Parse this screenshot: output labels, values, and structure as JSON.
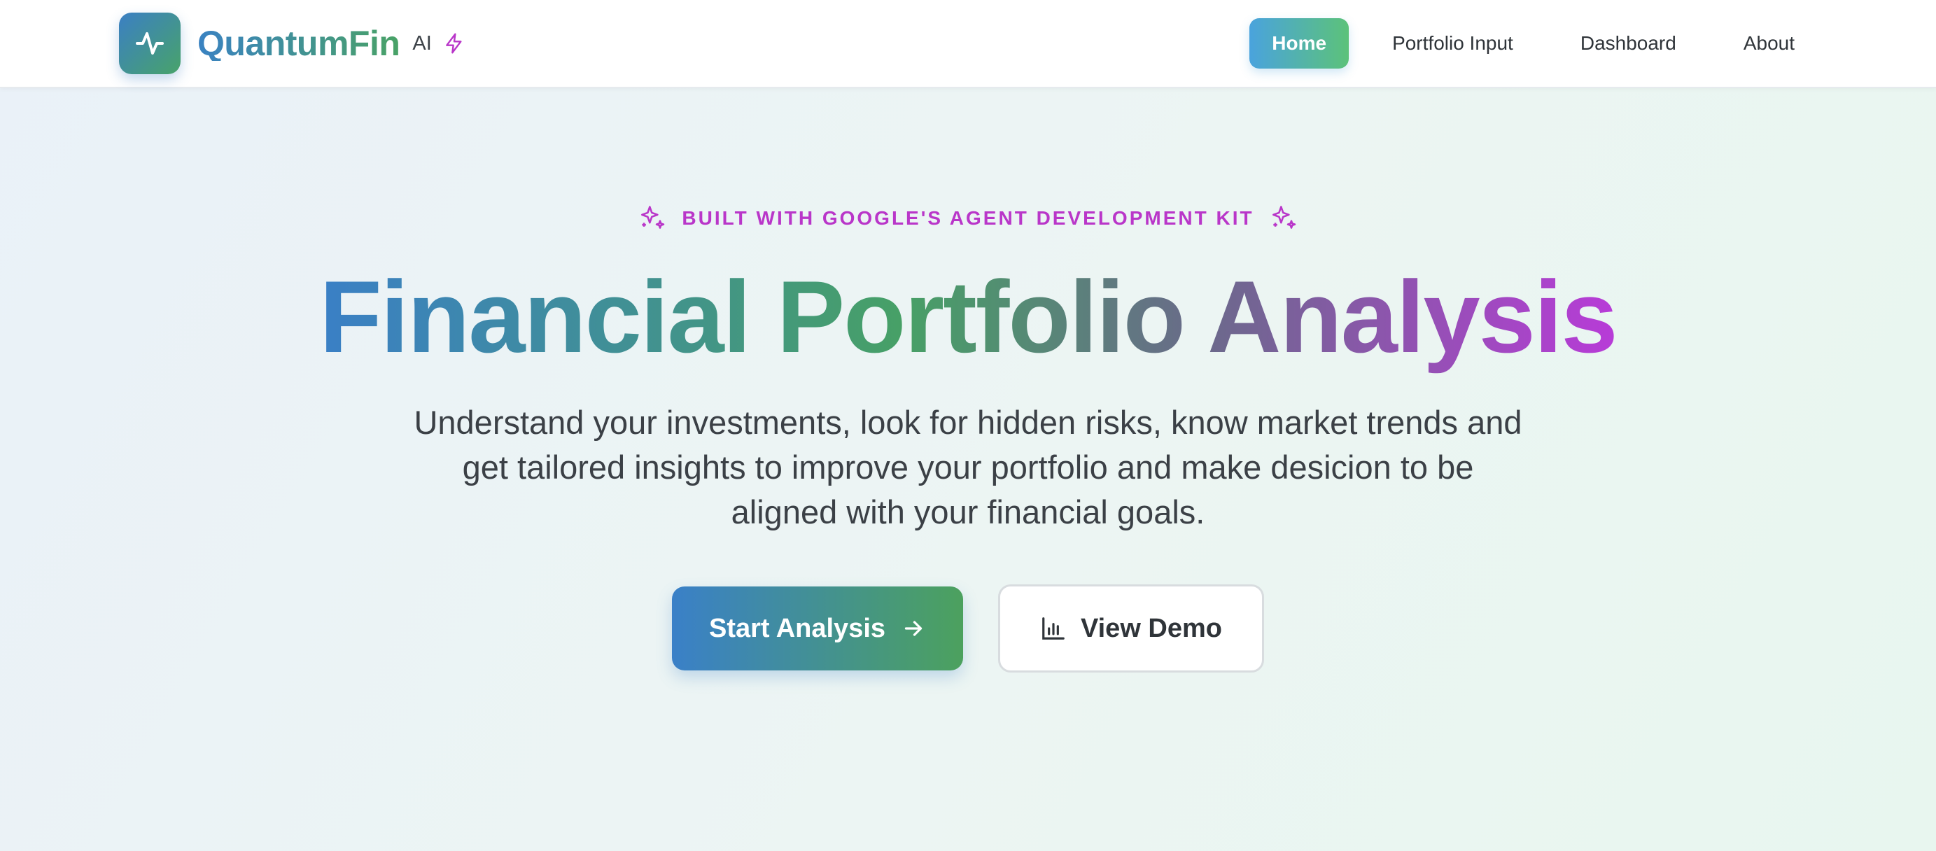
{
  "nav": {
    "brand_name": "QuantumFin",
    "brand_badge": "AI",
    "logo_icon": "activity-pulse-icon",
    "badge_icon": "lightning-bolt-icon",
    "links": [
      {
        "label": "Home",
        "active": true
      },
      {
        "label": "Portfolio Input",
        "active": false
      },
      {
        "label": "Dashboard",
        "active": false
      },
      {
        "label": "About",
        "active": false
      }
    ]
  },
  "hero": {
    "eyebrow": "BUILT WITH GOOGLE'S AGENT DEVELOPMENT KIT",
    "title": "Financial Portfolio Analysis",
    "subtitle": "Understand your investments, look for hidden risks, know market trends and get tailored insights to improve your portfolio and make desicion to be aligned with your financial goals.",
    "primary_cta": "Start Analysis",
    "secondary_cta": "View Demo"
  },
  "colors": {
    "brand_blue": "#3a80c8",
    "brand_green": "#4ca15e",
    "accent_purple": "#b936c9",
    "nav_active_start": "#4aa3dd",
    "nav_active_end": "#5cc27a"
  }
}
